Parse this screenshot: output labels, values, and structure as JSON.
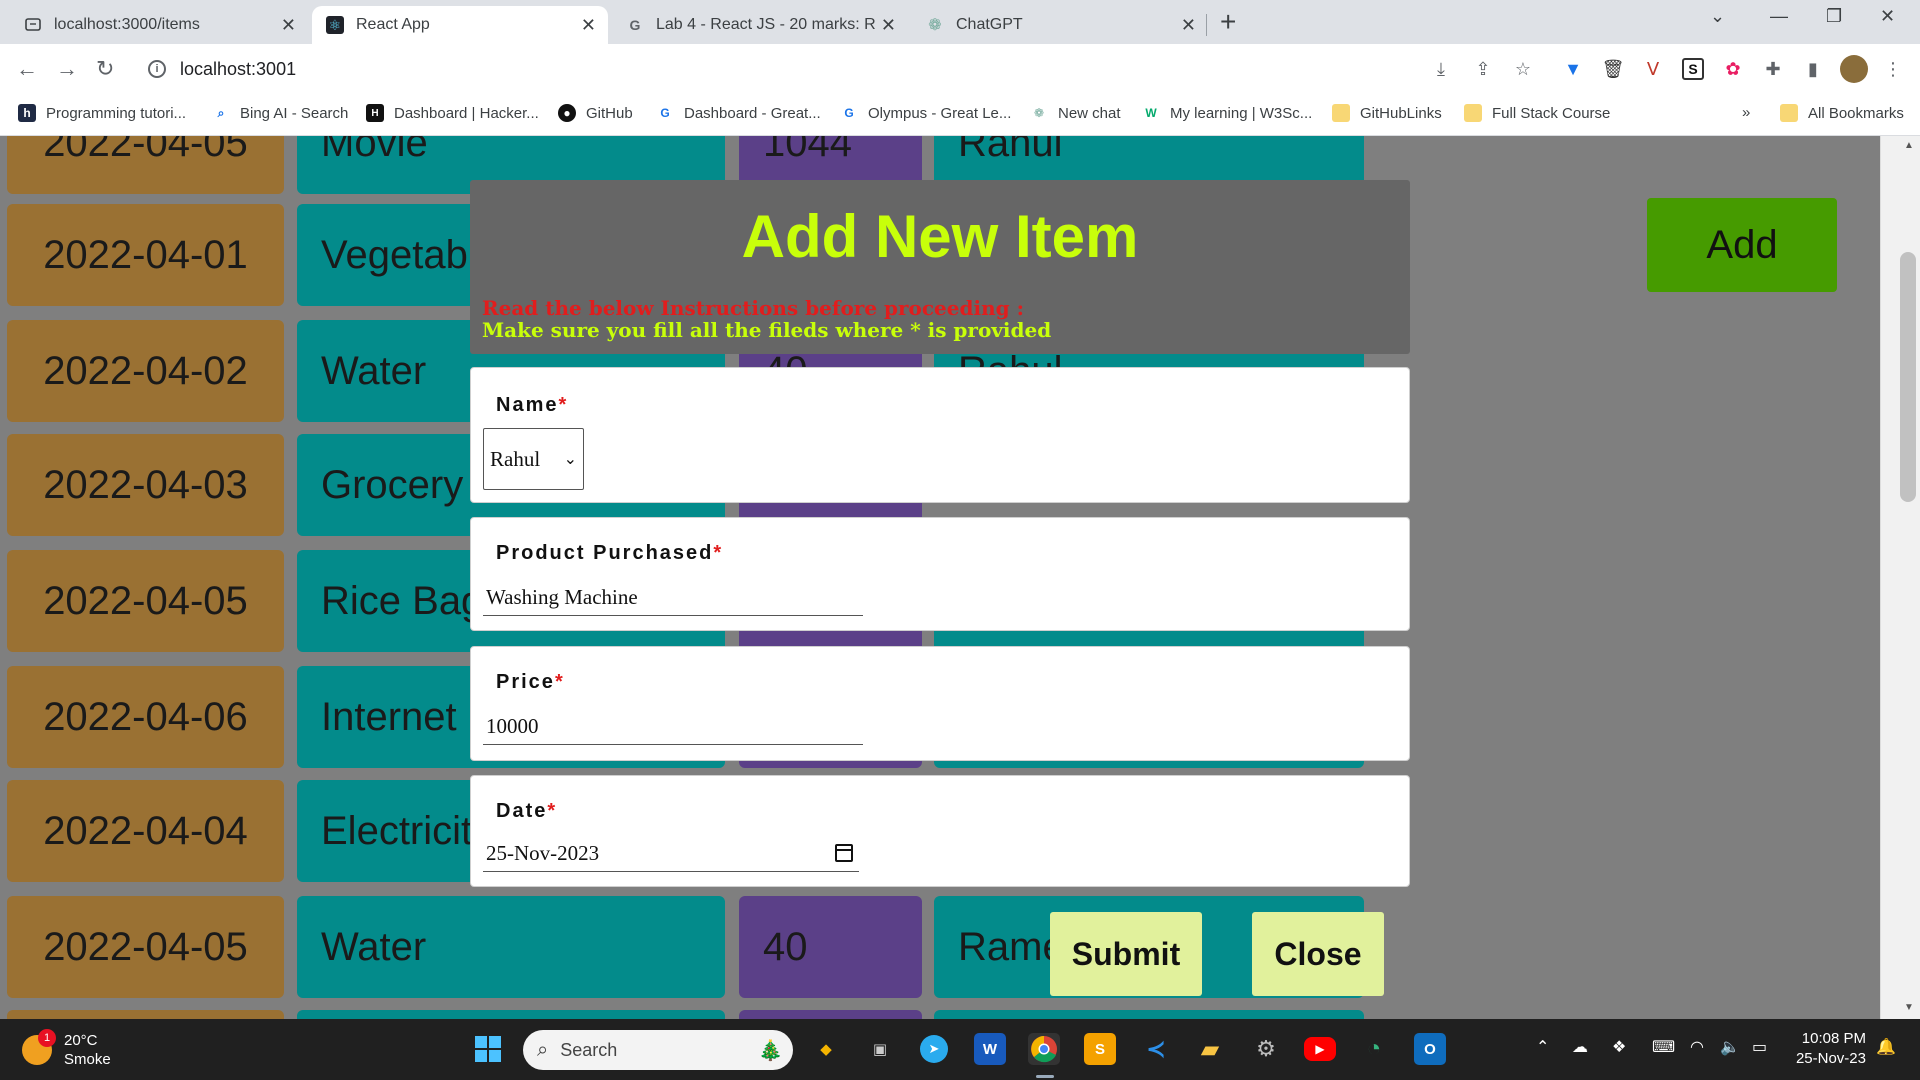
{
  "browser": {
    "tabs": [
      {
        "title": "localhost:3000/items",
        "active": false
      },
      {
        "title": "React App",
        "active": true
      },
      {
        "title": "Lab 4 - React JS - 20 marks: Reac",
        "active": false
      },
      {
        "title": "ChatGPT",
        "active": false
      }
    ],
    "url": "localhost:3001",
    "bookmarks": [
      "Programming tutori...",
      "Bing AI - Search",
      "Dashboard | Hacker...",
      "GitHub",
      "Dashboard - Great...",
      "Olympus - Great Le...",
      "New chat",
      "My learning | W3Sc...",
      "GitHubLinks",
      "Full Stack Course"
    ],
    "more_bookmarks": "»",
    "all_bookmarks": "All Bookmarks"
  },
  "rows": [
    {
      "date": "2022-04-05",
      "desc": "Movie",
      "amount": "1044",
      "user": "Rahul"
    },
    {
      "date": "2022-04-01",
      "desc": "Vegetab",
      "amount": "",
      "user": ""
    },
    {
      "date": "2022-04-02",
      "desc": "Water",
      "amount": "40",
      "user": "Rahul"
    },
    {
      "date": "2022-04-03",
      "desc": "Grocery",
      "amount": "",
      "user": ""
    },
    {
      "date": "2022-04-05",
      "desc": "Rice Bag",
      "amount": "",
      "user": ""
    },
    {
      "date": "2022-04-06",
      "desc": "Internet",
      "amount": "",
      "user": ""
    },
    {
      "date": "2022-04-04",
      "desc": "Electricit",
      "amount": "",
      "user": ""
    },
    {
      "date": "2022-04-05",
      "desc": "Water",
      "amount": "40",
      "user": "Rame"
    }
  ],
  "page": {
    "add_label": "Add"
  },
  "modal": {
    "title": "Add New Item",
    "instruction_heading": "Read the below Instructions before proceeding :",
    "instruction_text": "Make sure you fill all the fileds where * is provided",
    "name_label": "Name",
    "name_value": "Rahul",
    "product_label": "Product Purchased",
    "product_value": "Washing Machine",
    "price_label": "Price",
    "price_value": "10000",
    "date_label": "Date",
    "date_value": "25-Nov-2023",
    "required_mark": "*",
    "submit_label": "Submit",
    "close_label": "Close"
  },
  "taskbar": {
    "temperature": "20°C",
    "weather": "Smoke",
    "badge": "1",
    "search_placeholder": "Search",
    "time": "10:08 PM",
    "date": "25-Nov-23"
  },
  "colors": {
    "date_cell": "#9a7133",
    "teal_cell": "#038b8b",
    "purple_cell": "#5b4088",
    "add_button": "#469b00",
    "modal_title": "#c8ff0a",
    "required": "#e11d1d",
    "action_button": "#e1f19c"
  }
}
